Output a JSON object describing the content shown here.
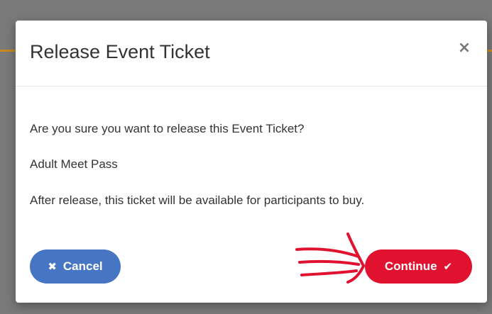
{
  "modal": {
    "title": "Release Event Ticket",
    "close_glyph": "×",
    "body": {
      "question": "Are you sure you want to release this Event Ticket?",
      "ticket_name": "Adult Meet Pass",
      "note": "After release, this ticket will be available for participants to buy."
    },
    "footer": {
      "cancel": {
        "label": "Cancel",
        "icon": "times-icon",
        "icon_glyph": "✖",
        "color": "#4676c3"
      },
      "continue": {
        "label": "Continue",
        "icon": "check-icon",
        "icon_glyph": "✔",
        "color": "#e0122f"
      }
    }
  },
  "annotation": {
    "icon": "hand-drawn-red-arrow",
    "color": "#e0122f"
  },
  "colors": {
    "backdrop": "#7a7a7a",
    "accent_line": "#c8891f",
    "text": "#333333"
  }
}
